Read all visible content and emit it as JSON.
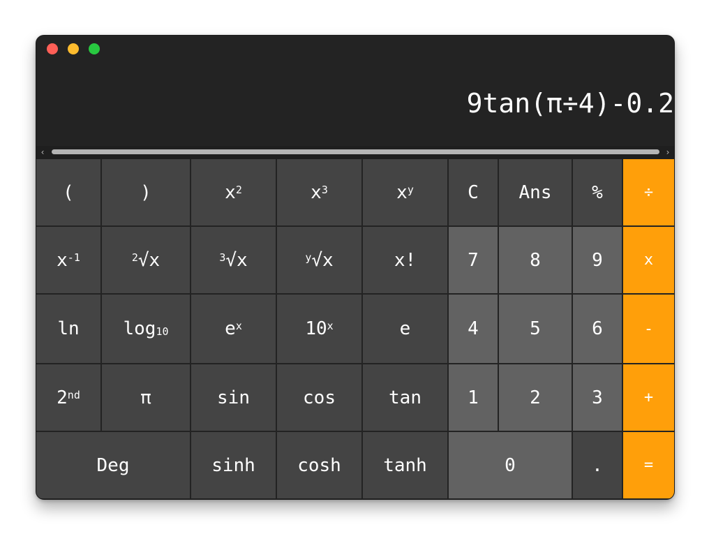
{
  "window_controls": [
    "close",
    "minimize",
    "maximize"
  ],
  "display": {
    "expression": "9tan(π÷4)-0.2"
  },
  "scrollbar": {
    "left_arrow": "‹",
    "right_arrow": "›"
  },
  "keys": {
    "open_paren": "(",
    "close_paren": ")",
    "x_squared": {
      "base": "x",
      "sup": "2"
    },
    "x_cubed": {
      "base": "x",
      "sup": "3"
    },
    "x_pow_y": {
      "base": "x",
      "sup": "y"
    },
    "clear": "C",
    "ans": "Ans",
    "percent": "%",
    "divide": "÷",
    "reciprocal": {
      "base": "x",
      "sup": "-1"
    },
    "sqrt": {
      "pre": "2",
      "main": "√x"
    },
    "cbrt": {
      "pre": "3",
      "main": "√x"
    },
    "yroot": {
      "pre": "y",
      "main": "√x"
    },
    "factorial": "x!",
    "d7": "7",
    "d8": "8",
    "d9": "9",
    "multiply": "x",
    "ln": "ln",
    "log10": {
      "base": "log",
      "sub": "10"
    },
    "e_pow_x": {
      "base": "e",
      "sup": "x"
    },
    "ten_pow_x": {
      "base": "10",
      "sup": "x"
    },
    "e": "e",
    "d4": "4",
    "d5": "5",
    "d6": "6",
    "minus": "-",
    "second": {
      "base": "2",
      "sup": "nd"
    },
    "pi": "π",
    "sin": "sin",
    "cos": "cos",
    "tan": "tan",
    "d1": "1",
    "d2": "2",
    "d3": "3",
    "plus": "+",
    "deg": "Deg",
    "sinh": "sinh",
    "cosh": "cosh",
    "tanh": "tanh",
    "d0": "0",
    "decimal": ".",
    "equals": "="
  },
  "colors": {
    "window_bg": "#232323",
    "function_key": "#444444",
    "digit_key": "#626262",
    "operator_key": "#ff9f0a",
    "close_dot": "#ff5f57",
    "minimize_dot": "#febc2e",
    "maximize_dot": "#28c840"
  }
}
